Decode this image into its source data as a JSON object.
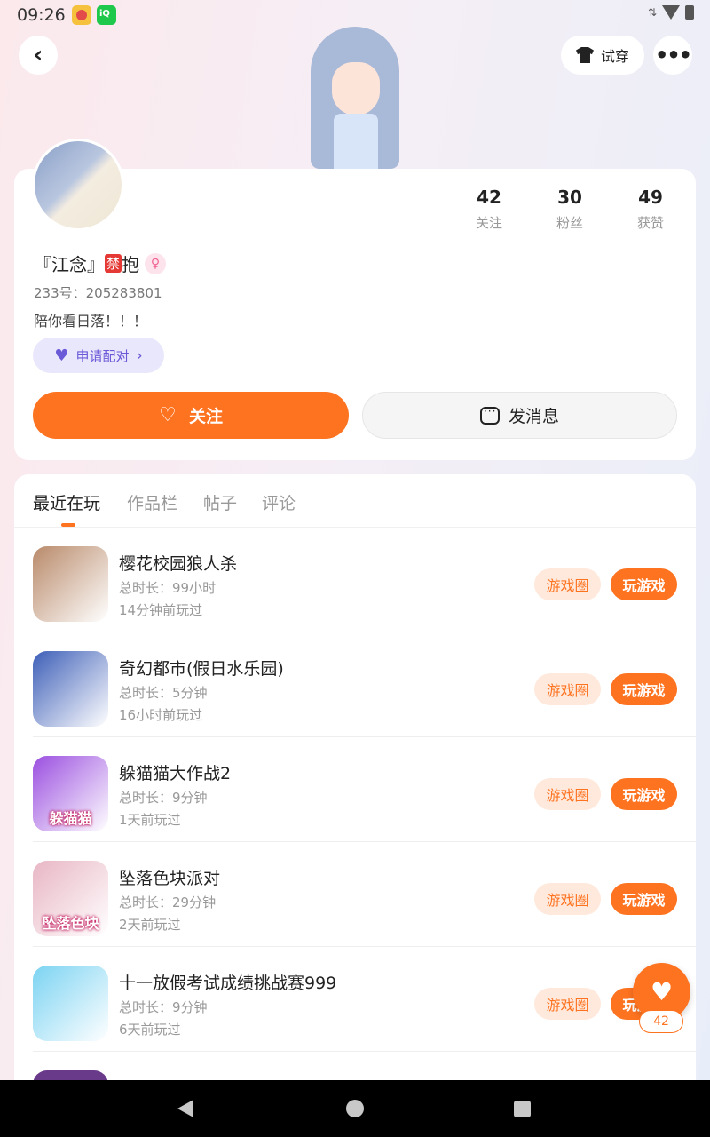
{
  "status": {
    "time": "09:26"
  },
  "top": {
    "tryon_label": "试穿"
  },
  "profile": {
    "stats": [
      {
        "num": "42",
        "label": "关注"
      },
      {
        "num": "30",
        "label": "粉丝"
      },
      {
        "num": "49",
        "label": "获赞"
      }
    ],
    "nickname_prefix": "『江念』",
    "nickname_badge": "禁",
    "nickname_suffix": "抱",
    "gender_symbol": "♀",
    "uid": "233号：205283801",
    "bio": "陪你看日落！！！",
    "pair_label": "申请配对",
    "follow_label": "关注",
    "message_label": "发消息"
  },
  "tabs": [
    "最近在玩",
    "作品栏",
    "帖子",
    "评论"
  ],
  "games": [
    {
      "title": "樱花校园狼人杀",
      "duration": "总时长：99小时",
      "last": "14分钟前玩过",
      "circle": "游戏圈",
      "play": "玩游戏",
      "tag": "",
      "color": "#b98a6a"
    },
    {
      "title": "奇幻都市(假日水乐园)",
      "duration": "总时长：5分钟",
      "last": "16小时前玩过",
      "circle": "游戏圈",
      "play": "玩游戏",
      "tag": "",
      "color": "#3e5fb8"
    },
    {
      "title": "躲猫猫大作战2",
      "duration": "总时长：9分钟",
      "last": "1天前玩过",
      "circle": "游戏圈",
      "play": "玩游戏",
      "tag": "躲猫猫",
      "color": "#9b4fe0"
    },
    {
      "title": "坠落色块派对",
      "duration": "总时长：29分钟",
      "last": "2天前玩过",
      "circle": "游戏圈",
      "play": "玩游戏",
      "tag": "坠落色块",
      "color": "#e8b6c4"
    },
    {
      "title": "十一放假考试成绩挑战赛999",
      "duration": "总时长：9分钟",
      "last": "6天前玩过",
      "circle": "游戏圈",
      "play": "玩游戏",
      "tag": "",
      "color": "#7bd3f2"
    }
  ],
  "fab": {
    "count": "42"
  }
}
